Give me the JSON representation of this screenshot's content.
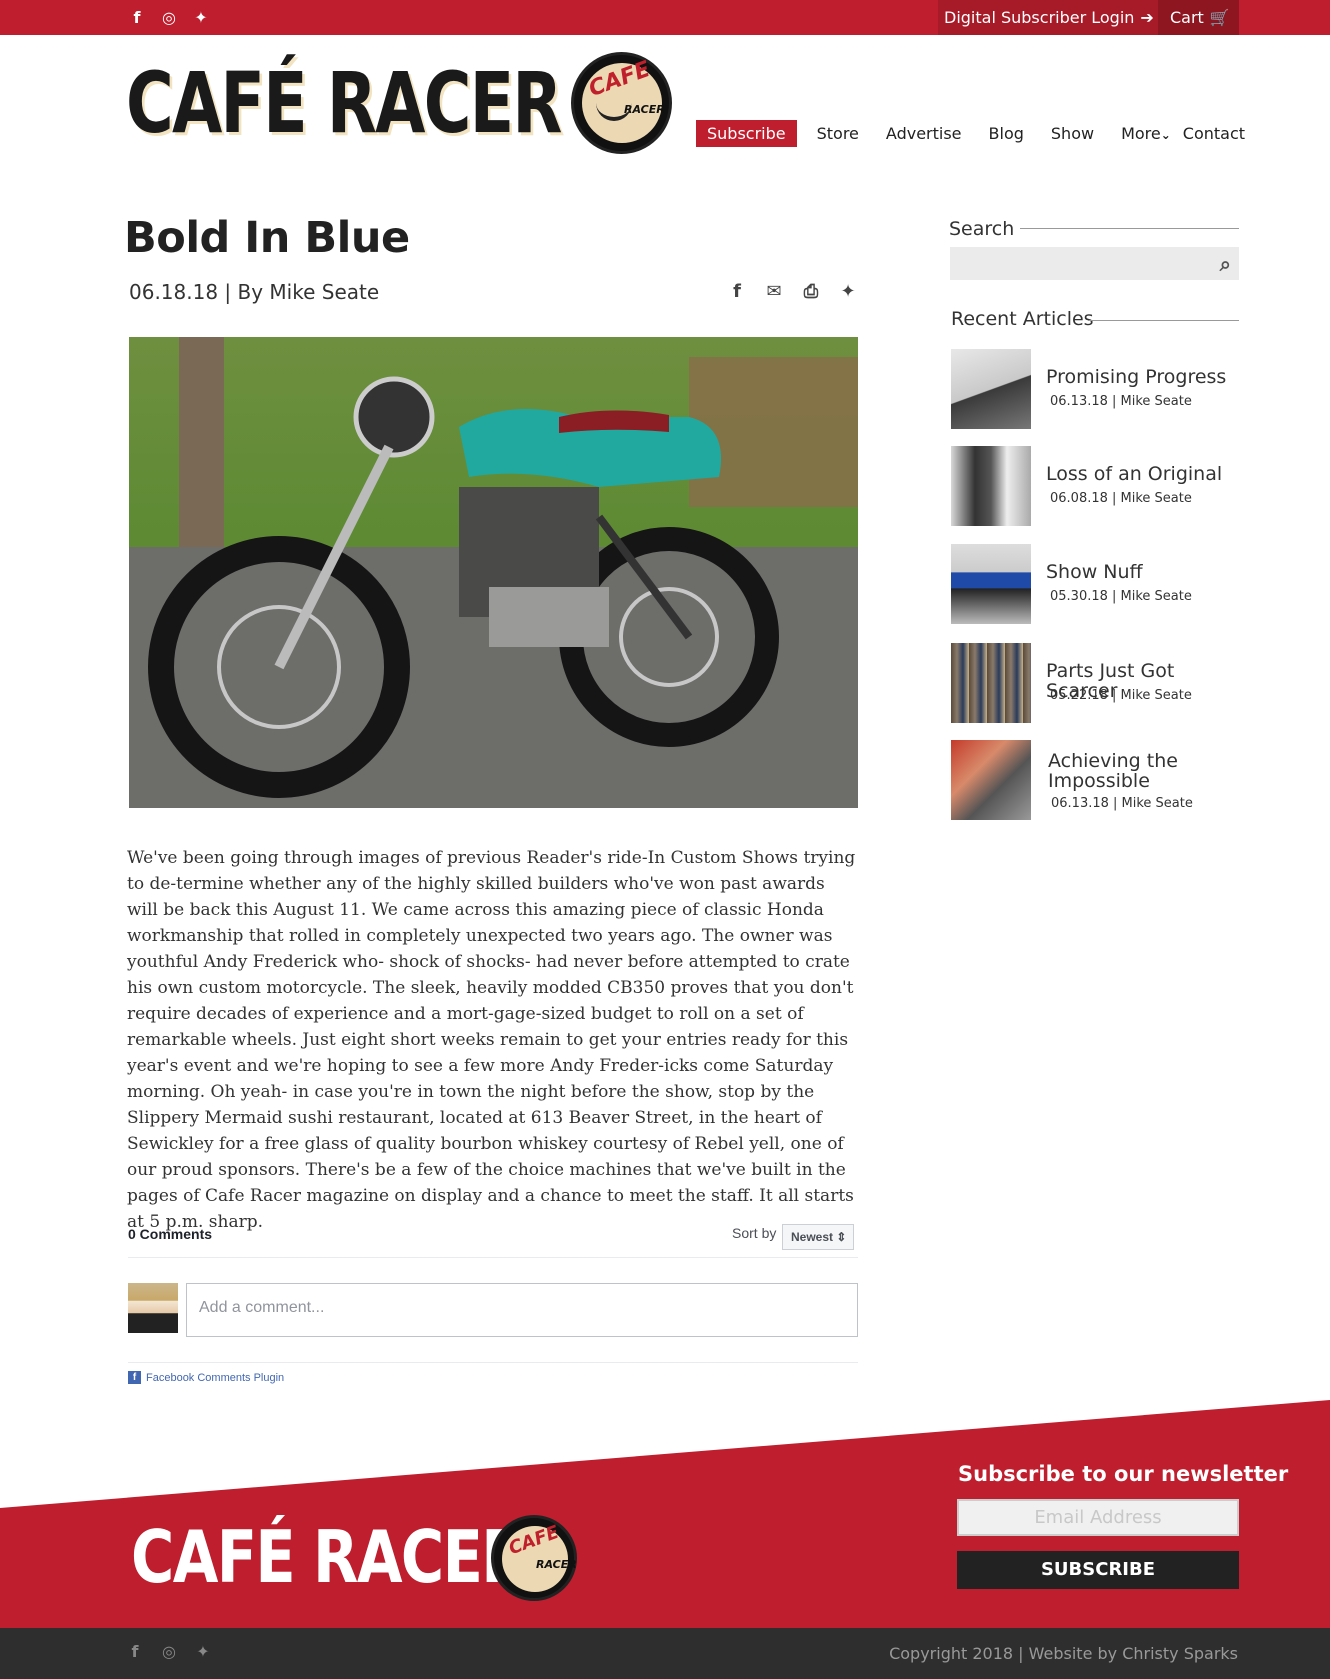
{
  "topbar": {
    "social_icons": [
      "facebook-icon",
      "instagram-icon",
      "twitter-icon"
    ],
    "login_label": "Digital Subscriber Login",
    "cart_label": "Cart"
  },
  "brand": {
    "logo_text": "CAFÉ RACER",
    "badge_top": "CAFE",
    "badge_bottom": "RACER"
  },
  "nav": {
    "subscribe": "Subscribe",
    "store": "Store",
    "advertise": "Advertise",
    "blog": "Blog",
    "show": "Show",
    "more": "More",
    "contact": "Contact"
  },
  "article": {
    "title": "Bold In Blue",
    "meta": "06.18.18 | By Mike Seate",
    "share_icons": [
      "facebook-icon",
      "email-icon",
      "print-icon",
      "twitter-icon"
    ],
    "body": "We've been going through images of previous Reader's ride-In Custom Shows trying to de-termine whether any of the highly skilled builders who've won past awards will be back this August 11. We came across this amazing piece of classic Honda workmanship that rolled in completely unexpected two years ago. The owner was youthful Andy Frederick who- shock of shocks- had never before attempted to crate his own custom motorcycle. The sleek, heavily modded CB350 proves that you don't require decades of experience and  a mort-gage-sized budget to roll on a set of remarkable wheels. Just eight short weeks remain to get your entries ready for this year's event and we're hoping to see a few more Andy Freder-icks come Saturday morning. Oh yeah- in case you're in town the night before the show, stop by the Slippery Mermaid sushi restaurant, located at 613 Beaver Street, in the heart of Sewickley for a free glass of quality bourbon whiskey courtesy of Rebel yell, one of our proud sponsors. There's be a few of the choice machines that we've built in the pages of Cafe Racer magazine on display and a chance to meet the staff. It all starts at 5 p.m. sharp."
  },
  "comments": {
    "count": "0 Comments",
    "sort_label": "Sort by",
    "sort_value": "Newest ⇕",
    "placeholder": "Add a comment...",
    "plugin_label": "Facebook Comments Plugin"
  },
  "sidebar": {
    "search_heading": "Search",
    "recent_heading": "Recent Articles",
    "articles": [
      {
        "title": "Promising Progress",
        "date": "06.13.18 | Mike Seate"
      },
      {
        "title": "Loss of an Original",
        "date": "06.08.18 | Mike Seate"
      },
      {
        "title": "Show Nuff",
        "date": "05.30.18 | Mike Seate"
      },
      {
        "title": "Parts Just Got Scarcer",
        "date": "05.22.18 | Mike Seate"
      },
      {
        "title": "Achieving the Impossible",
        "date": "06.13.18 | Mike Seate"
      }
    ]
  },
  "footer": {
    "newsletter_heading": "Subscribe to our newsletter",
    "email_placeholder": "Email Address",
    "subscribe_button": "SUBSCRIBE",
    "copyright": "Copyright 2018 | Website by Christy Sparks"
  },
  "colors": {
    "brand_red": "#be1e2d",
    "dark": "#2e2e2e"
  }
}
